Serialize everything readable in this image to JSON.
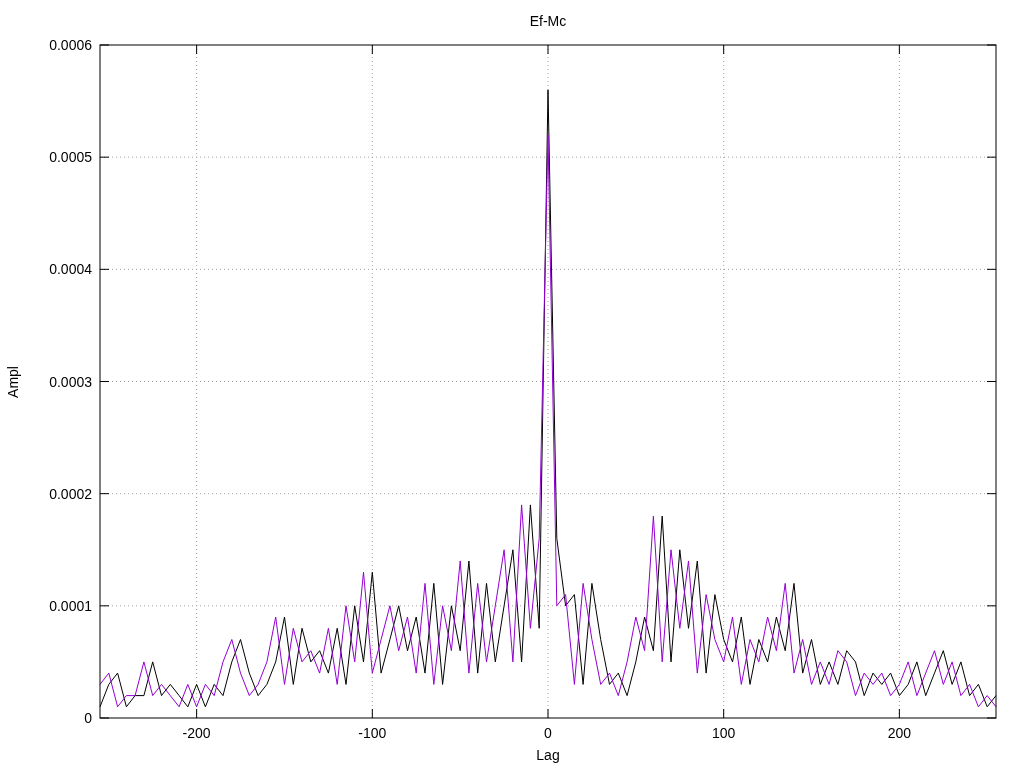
{
  "chart": {
    "chart_data": {
      "type": "line",
      "title": "Ef-Mc",
      "xlabel": "Lag",
      "ylabel": "Ampl",
      "x": [
        -255,
        -250,
        -245,
        -240,
        -235,
        -230,
        -225,
        -220,
        -215,
        -210,
        -205,
        -200,
        -195,
        -190,
        -185,
        -180,
        -175,
        -170,
        -165,
        -160,
        -155,
        -150,
        -145,
        -140,
        -135,
        -130,
        -125,
        -120,
        -115,
        -110,
        -105,
        -100,
        -95,
        -90,
        -85,
        -80,
        -75,
        -70,
        -65,
        -60,
        -55,
        -50,
        -45,
        -40,
        -35,
        -30,
        -25,
        -20,
        -15,
        -10,
        -5,
        0,
        5,
        10,
        15,
        20,
        25,
        30,
        35,
        40,
        45,
        50,
        55,
        60,
        65,
        70,
        75,
        80,
        85,
        90,
        95,
        100,
        105,
        110,
        115,
        120,
        125,
        130,
        135,
        140,
        145,
        150,
        155,
        160,
        165,
        170,
        175,
        180,
        185,
        190,
        195,
        200,
        205,
        210,
        215,
        220,
        225,
        230,
        235,
        240,
        245,
        250,
        255
      ],
      "series": [
        {
          "color": "#000000",
          "values": [
            1e-05,
            3e-05,
            4e-05,
            1e-05,
            2e-05,
            2e-05,
            5e-05,
            2e-05,
            3e-05,
            2e-05,
            1e-05,
            3e-05,
            1e-05,
            3e-05,
            2e-05,
            5e-05,
            7e-05,
            4e-05,
            2e-05,
            3e-05,
            5e-05,
            9e-05,
            3e-05,
            8e-05,
            5e-05,
            6e-05,
            4e-05,
            8e-05,
            3e-05,
            0.0001,
            5e-05,
            0.00013,
            4e-05,
            7e-05,
            0.0001,
            6e-05,
            9e-05,
            4e-05,
            0.00012,
            3e-05,
            0.0001,
            6e-05,
            0.00014,
            4e-05,
            0.00012,
            5e-05,
            0.0001,
            0.00015,
            5e-05,
            0.00019,
            8e-05,
            0.00056,
            0.00016,
            0.0001,
            0.00011,
            3e-05,
            0.00012,
            7e-05,
            3e-05,
            4e-05,
            2e-05,
            5e-05,
            9e-05,
            6e-05,
            0.00018,
            5e-05,
            0.00015,
            8e-05,
            0.00014,
            4e-05,
            0.00011,
            7e-05,
            5e-05,
            9e-05,
            3e-05,
            7e-05,
            5e-05,
            9e-05,
            6e-05,
            0.00012,
            4e-05,
            7e-05,
            3e-05,
            5e-05,
            3e-05,
            6e-05,
            5e-05,
            2e-05,
            4e-05,
            3e-05,
            4e-05,
            2e-05,
            3e-05,
            5e-05,
            2e-05,
            4e-05,
            6e-05,
            3e-05,
            5e-05,
            2e-05,
            3e-05,
            1e-05,
            2e-05
          ]
        },
        {
          "color": "#9400d3",
          "values": [
            3e-05,
            4e-05,
            1e-05,
            2e-05,
            2e-05,
            5e-05,
            2e-05,
            3e-05,
            2e-05,
            1e-05,
            3e-05,
            1e-05,
            3e-05,
            2e-05,
            5e-05,
            7e-05,
            4e-05,
            2e-05,
            3e-05,
            5e-05,
            9e-05,
            3e-05,
            8e-05,
            5e-05,
            6e-05,
            4e-05,
            8e-05,
            3e-05,
            0.0001,
            5e-05,
            0.00013,
            4e-05,
            7e-05,
            0.0001,
            6e-05,
            9e-05,
            4e-05,
            0.00012,
            3e-05,
            0.0001,
            6e-05,
            0.00014,
            4e-05,
            0.00012,
            5e-05,
            0.0001,
            0.00015,
            5e-05,
            0.00019,
            8e-05,
            0.00016,
            0.00052,
            0.0001,
            0.00011,
            3e-05,
            0.00012,
            7e-05,
            3e-05,
            4e-05,
            2e-05,
            5e-05,
            9e-05,
            6e-05,
            0.00018,
            5e-05,
            0.00015,
            8e-05,
            0.00014,
            4e-05,
            0.00011,
            7e-05,
            5e-05,
            9e-05,
            3e-05,
            7e-05,
            5e-05,
            9e-05,
            6e-05,
            0.00012,
            4e-05,
            7e-05,
            3e-05,
            5e-05,
            3e-05,
            6e-05,
            5e-05,
            2e-05,
            4e-05,
            3e-05,
            4e-05,
            2e-05,
            3e-05,
            5e-05,
            2e-05,
            4e-05,
            6e-05,
            3e-05,
            5e-05,
            2e-05,
            3e-05,
            1e-05,
            2e-05,
            1e-05
          ]
        }
      ],
      "grid": true,
      "xlim": [
        -255,
        255
      ],
      "ylim": [
        0,
        0.0006
      ],
      "xticks": [
        -200,
        -100,
        0,
        100,
        200
      ],
      "yticks": [
        {
          "value": 0,
          "label": "0"
        },
        {
          "value": 0.0001,
          "label": "0.0001"
        },
        {
          "value": 0.0002,
          "label": "0.0002"
        },
        {
          "value": 0.0003,
          "label": "0.0003"
        },
        {
          "value": 0.0004,
          "label": "0.0004"
        },
        {
          "value": 0.0005,
          "label": "0.0005"
        },
        {
          "value": 0.0006,
          "label": "0.0006"
        }
      ]
    }
  }
}
